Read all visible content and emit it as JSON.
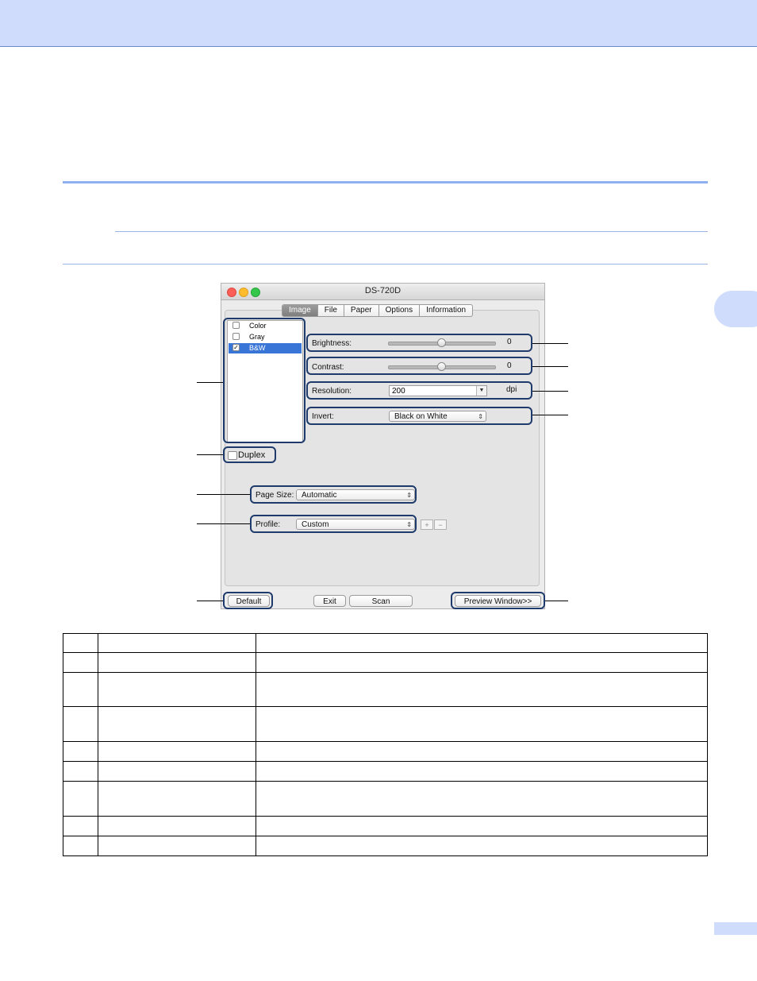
{
  "window": {
    "title": "DS-720D",
    "tabs": [
      {
        "label": "Image",
        "active": true
      },
      {
        "label": "File",
        "active": false
      },
      {
        "label": "Paper",
        "active": false
      },
      {
        "label": "Options",
        "active": false
      },
      {
        "label": "Information",
        "active": false
      }
    ],
    "image_modes": [
      {
        "label": "Color",
        "checked": false
      },
      {
        "label": "Gray",
        "checked": false
      },
      {
        "label": "B&W",
        "checked": true
      }
    ],
    "brightness": {
      "label": "Brightness:",
      "value": "0",
      "slider_level": 0.5
    },
    "contrast": {
      "label": "Contrast:",
      "value": "0",
      "slider_level": 0.5
    },
    "resolution": {
      "label": "Resolution:",
      "value": "200",
      "unit": "dpi"
    },
    "invert": {
      "label": "Invert:",
      "value": "Black on White"
    },
    "duplex": {
      "label": "Duplex",
      "checked": false
    },
    "page_size": {
      "label": "Page Size:",
      "value": "Automatic"
    },
    "profile": {
      "label": "Profile:",
      "value": "Custom",
      "add": "+",
      "remove": "−"
    },
    "buttons": {
      "default": "Default",
      "exit": "Exit",
      "scan": "Scan",
      "preview": "Preview Window>>"
    }
  },
  "colors": {
    "header_band": "#cfdcfb",
    "rule": "#8fb0ee",
    "callout": "#1f3b6b",
    "selection": "#3875d7"
  },
  "table": {
    "rows": [
      {
        "height": 24
      },
      {
        "height": 25
      },
      {
        "height": 43
      },
      {
        "height": 44
      },
      {
        "height": 25
      },
      {
        "height": 25
      },
      {
        "height": 44
      },
      {
        "height": 25
      },
      {
        "height": 25
      }
    ]
  }
}
